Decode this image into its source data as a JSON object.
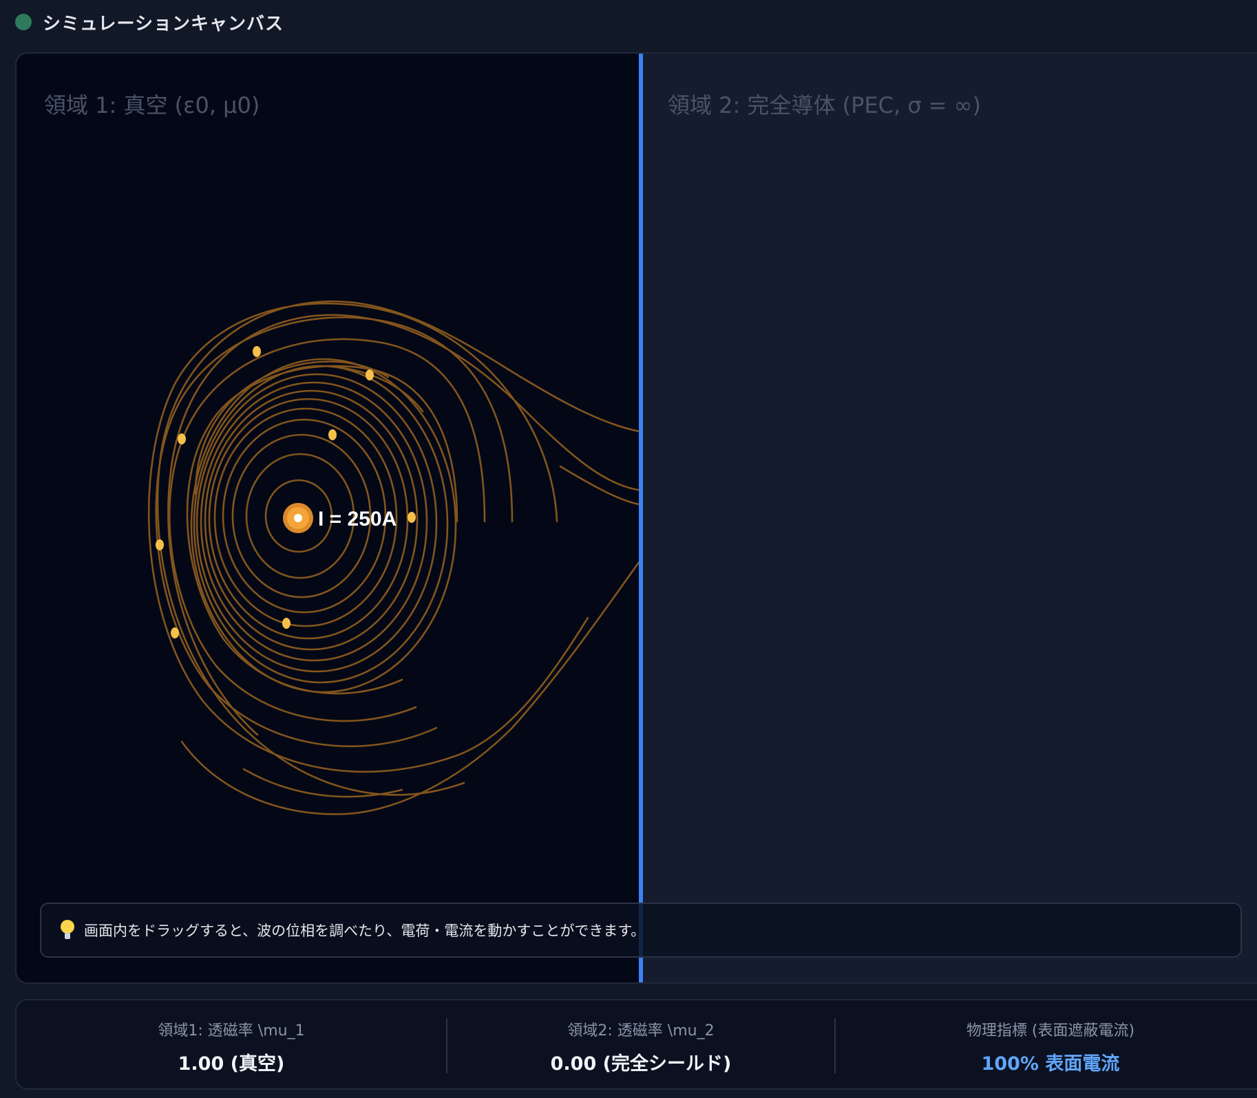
{
  "header": {
    "title": "シミュレーションキャンバス",
    "status_color": "#2f7a5d"
  },
  "canvas": {
    "region1_label": "領域 1: 真空 (ε0, μ0)",
    "region2_label": "領域 2: 完全導体 (PEC, σ = ∞)",
    "current_label": "I = 250A",
    "boundary_color": "#3b82f6",
    "field_line_color": "#8a5a1e",
    "particle_color": "#f5c04a"
  },
  "hint": {
    "icon": "lightbulb-icon",
    "text": "画面内をドラッグすると、波の位相を調べたり、電荷・電流を動かすことができます。"
  },
  "stats": [
    {
      "label": "領域1: 透磁率 \\mu_1",
      "value": "1.00 (真空)"
    },
    {
      "label": "領域2: 透磁率 \\mu_2",
      "value": "0.00 (完全シールド)"
    },
    {
      "label": "物理指標 (表面遮蔽電流)",
      "value": "100% 表面電流",
      "accent": "#60a5fa"
    }
  ]
}
